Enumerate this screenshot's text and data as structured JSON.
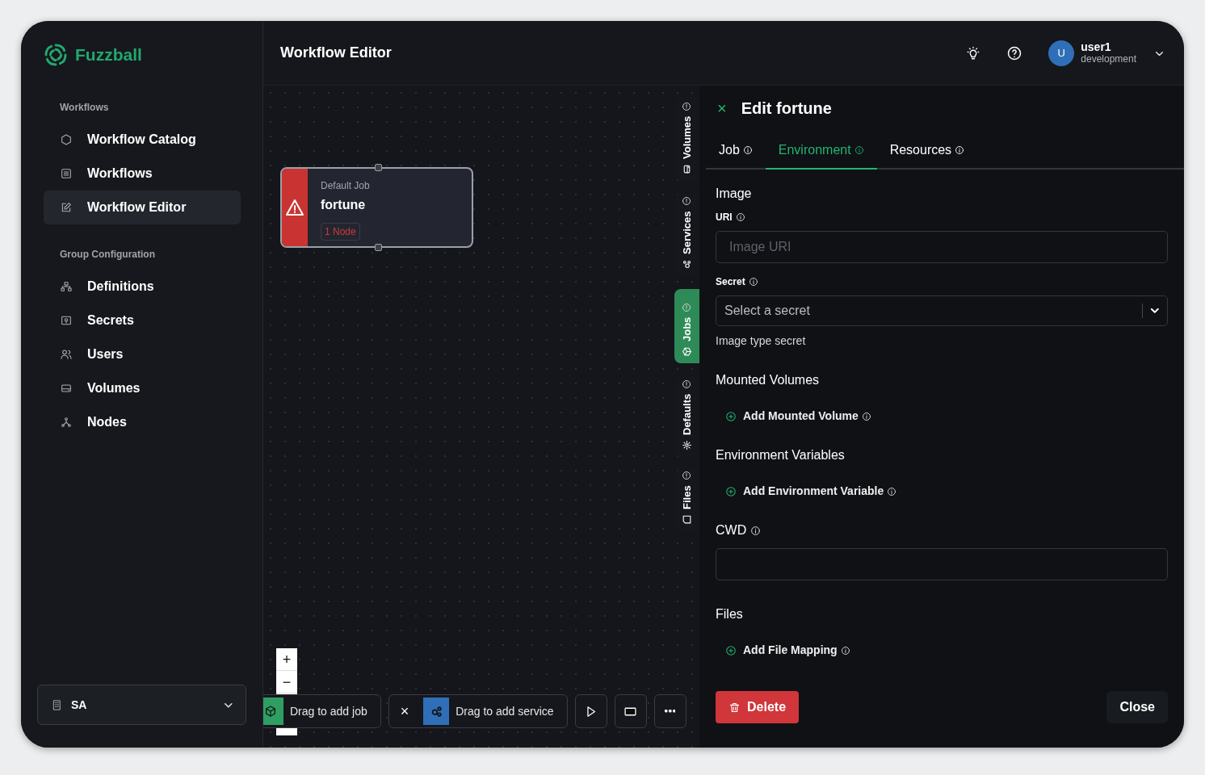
{
  "app": {
    "logo": "Fuzzball"
  },
  "sidebar": {
    "sections": [
      {
        "title": "Workflows",
        "items": [
          {
            "label": "Workflow Catalog",
            "selected": false
          },
          {
            "label": "Workflows",
            "selected": false
          },
          {
            "label": "Workflow Editor",
            "selected": true
          }
        ]
      },
      {
        "title": "Group Configuration",
        "items": [
          {
            "label": "Definitions",
            "selected": false
          },
          {
            "label": "Secrets",
            "selected": false
          },
          {
            "label": "Users",
            "selected": false
          },
          {
            "label": "Volumes",
            "selected": false
          },
          {
            "label": "Nodes",
            "selected": false
          }
        ]
      }
    ],
    "org_selector": {
      "label": "SA"
    }
  },
  "header": {
    "title": "Workflow Editor",
    "user": {
      "initial": "U",
      "name": "user1",
      "environment": "development"
    }
  },
  "canvas": {
    "nodes": [
      {
        "type": "Default Job",
        "name": "fortune",
        "badge": "1 Node"
      }
    ],
    "zoom_controls": [
      "+",
      "−"
    ],
    "toolbar": {
      "job_drag": "Drag to add job",
      "clear": "×",
      "service_drag": "Drag to add service"
    }
  },
  "side_tabs": [
    {
      "label": "Volumes",
      "selected": false
    },
    {
      "label": "Services",
      "selected": false
    },
    {
      "label": "Jobs",
      "selected": true
    },
    {
      "label": "Defaults",
      "selected": false
    },
    {
      "label": "Files",
      "selected": false
    }
  ],
  "panel": {
    "close": "×",
    "title": "Edit fortune",
    "tabs": [
      {
        "label": "Job",
        "selected": false
      },
      {
        "label": "Environment",
        "selected": true
      },
      {
        "label": "Resources",
        "selected": false
      }
    ],
    "form": [
      {
        "kind": "heading",
        "text": "Image",
        "info": false
      },
      {
        "kind": "label",
        "text": "URI",
        "info": true
      },
      {
        "kind": "input",
        "placeholder": "Image URI"
      },
      {
        "kind": "label",
        "text": "Secret",
        "info": true
      },
      {
        "kind": "select",
        "placeholder": "Select a secret"
      },
      {
        "kind": "help",
        "text": "Image type secret"
      },
      {
        "kind": "heading",
        "text": "Mounted Volumes",
        "info": false
      },
      {
        "kind": "add",
        "text": "Add Mounted Volume",
        "info": true
      },
      {
        "kind": "heading",
        "text": "Environment Variables",
        "info": false
      },
      {
        "kind": "add",
        "text": "Add Environment Variable",
        "info": true
      },
      {
        "kind": "heading",
        "text": "CWD",
        "info": true
      },
      {
        "kind": "input"
      },
      {
        "kind": "heading",
        "text": "Files",
        "info": false
      },
      {
        "kind": "add",
        "text": "Add File Mapping",
        "info": true
      }
    ],
    "delete": "Delete",
    "close_button": "Close"
  }
}
